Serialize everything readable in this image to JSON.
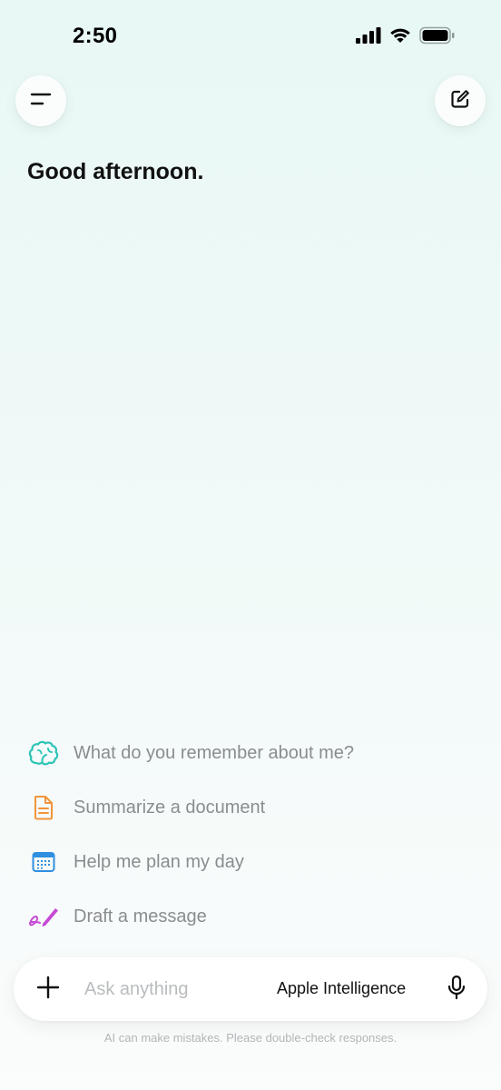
{
  "status_bar": {
    "time": "2:50",
    "icons": [
      "cellular-signal-icon",
      "wifi-icon",
      "battery-icon"
    ]
  },
  "header": {
    "left_icon": "menu-icon",
    "right_icon": "compose-icon"
  },
  "greeting": "Good afternoon.",
  "suggestions": [
    {
      "icon": "brain-icon",
      "label": "What do you remember about me?",
      "color": "#2ec4b6"
    },
    {
      "icon": "document-icon",
      "label": "Summarize a document",
      "color": "#f2933a"
    },
    {
      "icon": "calendar-icon",
      "label": "Help me plan my day",
      "color": "#2f8fe0"
    },
    {
      "icon": "pen-icon",
      "label": "Draft a message",
      "color": "#c64ad6"
    }
  ],
  "composer": {
    "plus_icon": "plus-icon",
    "placeholder": "Ask anything",
    "model": "Apple Intelligence",
    "mic_icon": "microphone-icon"
  },
  "disclaimer": "AI can make mistakes. Please double-check responses."
}
